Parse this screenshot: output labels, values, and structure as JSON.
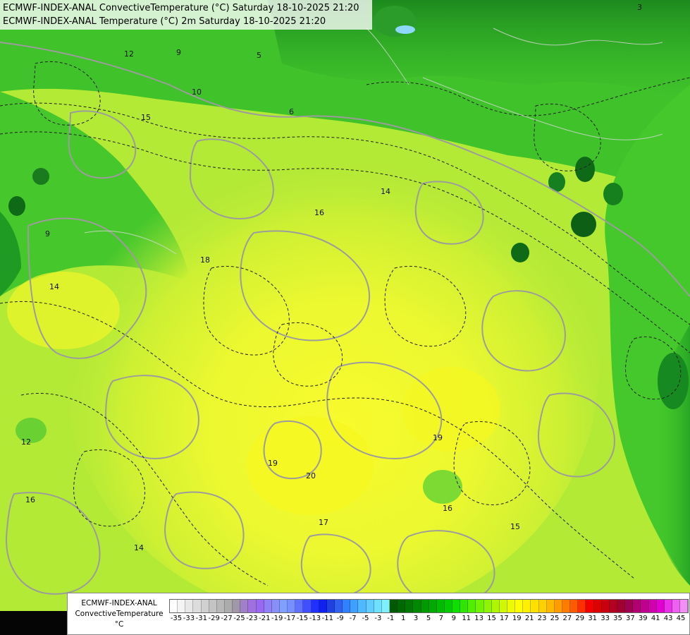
{
  "map": {
    "title_line1": "ECMWF-INDEX-ANAL ConvectiveTemperature (°C) Saturday 18-10-2025 21:20",
    "title_line2": "ECMWF-INDEX-ANAL Temperature (°C) 2m Saturday 18-10-2025 21:20",
    "contour_labels": [
      "12",
      "9",
      "5",
      "10",
      "6",
      "3",
      "15",
      "14",
      "16",
      "18",
      "19",
      "20",
      "17",
      "14",
      "16",
      "19",
      "15",
      "12",
      "16",
      "14",
      "9"
    ]
  },
  "legend": {
    "label_lines": [
      "ECMWF-INDEX-ANAL",
      "ConvectiveTemperature",
      "°C"
    ],
    "ticks": [
      "-35",
      "-33",
      "-31",
      "-29",
      "-27",
      "-25",
      "-23",
      "-21",
      "-19",
      "-17",
      "-15",
      "-13",
      "-11",
      "-9",
      "-7",
      "-5",
      "-3",
      "-1",
      "1",
      "3",
      "5",
      "7",
      "9",
      "11",
      "13",
      "15",
      "17",
      "19",
      "21",
      "23",
      "25",
      "27",
      "29",
      "31",
      "33",
      "35",
      "37",
      "39",
      "41",
      "43",
      "45"
    ],
    "colors": [
      "#ffffff",
      "#f4f4f4",
      "#e8e8e8",
      "#dcdcdc",
      "#d0d0d0",
      "#c4c4c4",
      "#b8b8b8",
      "#acacac",
      "#a098a8",
      "#a080c8",
      "#a070e0",
      "#9868f0",
      "#9080f8",
      "#8890f8",
      "#80a0ff",
      "#7890ff",
      "#6070ff",
      "#4050ff",
      "#2030ff",
      "#1020f0",
      "#2040e0",
      "#3060f0",
      "#3080ff",
      "#40a0ff",
      "#50b8ff",
      "#60ccff",
      "#70e0ff",
      "#80f0ff",
      "#005a00",
      "#006800",
      "#007800",
      "#008800",
      "#009a00",
      "#00aa00",
      "#00bb00",
      "#00cc00",
      "#10dd00",
      "#30e600",
      "#50ee00",
      "#70f200",
      "#90f400",
      "#b0f600",
      "#d0f800",
      "#eefa00",
      "#ffff00",
      "#fff000",
      "#ffe000",
      "#ffd000",
      "#ffb800",
      "#ff9c00",
      "#ff7c00",
      "#ff5a00",
      "#ff3000",
      "#f00000",
      "#dc0000",
      "#c80010",
      "#b40020",
      "#a00030",
      "#a00050",
      "#b00070",
      "#c00090",
      "#d000b0",
      "#e000d0",
      "#e830e8",
      "#ee60f0",
      "#f090f4"
    ]
  }
}
